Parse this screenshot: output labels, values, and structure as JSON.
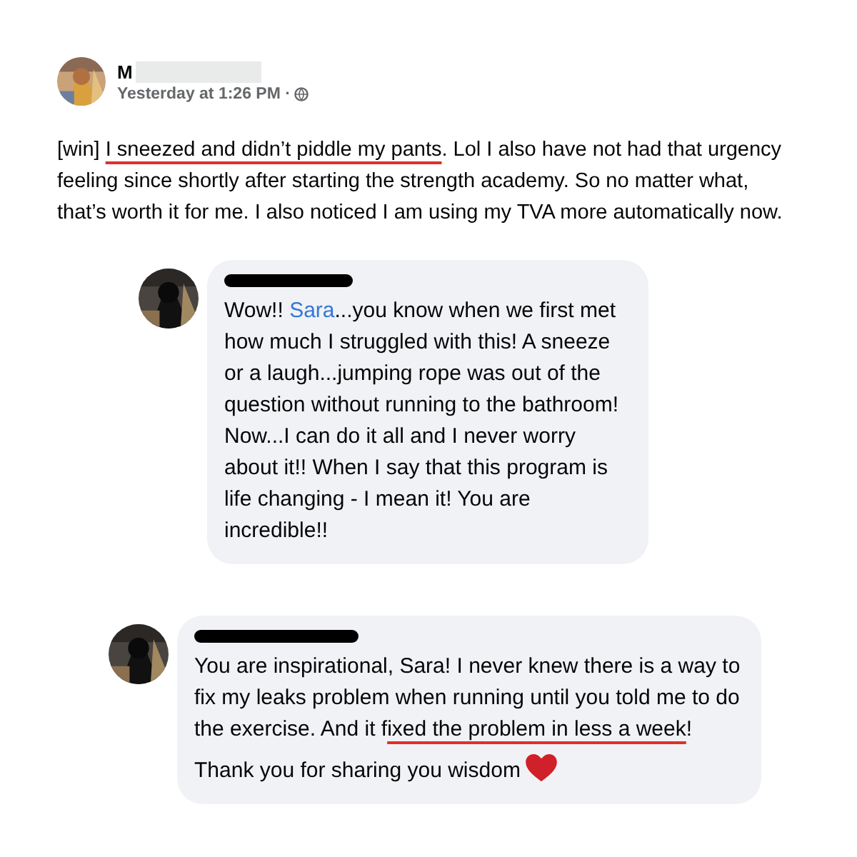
{
  "post": {
    "author": "M",
    "time": "Yesterday at 1:26 PM ·",
    "body": [
      {
        "text": "[win] ",
        "kind": "plain"
      },
      {
        "text": "I sneezed and didn’t piddle my pants",
        "kind": "underlined"
      },
      {
        "text": ". Lol I also have not had that urgency feeling since shortly after starting the strength academy. So no matter what, that’s worth it for me. I also noticed I am using my TVA more automatically now.",
        "kind": "plain"
      }
    ]
  },
  "comments": [
    {
      "author_redacted": true,
      "paragraphs": [
        [
          {
            "text": "Wow!! ",
            "kind": "plain"
          },
          {
            "text": "Sara",
            "kind": "mention"
          },
          {
            "text": "...you know when we first met how much I struggled with this! A sneeze or a laugh...jumping rope was out of the question without running to the bathroom! Now...I can do it all and I never worry about it!! When I say that this program is life changing - I mean it! You are incredible!!",
            "kind": "plain"
          }
        ]
      ]
    },
    {
      "author_redacted": true,
      "paragraphs": [
        [
          {
            "text": "You are inspirational, Sara! I never knew there is a way to fix my leaks problem when running until you told me to do the exercise. And it f",
            "kind": "plain"
          },
          {
            "text": "ixed the problem in less a week",
            "kind": "underlined"
          },
          {
            "text": "!",
            "kind": "plain"
          }
        ],
        [
          {
            "text": "Thank you for sharing you wisdom",
            "kind": "plain"
          },
          {
            "kind": "heart"
          }
        ]
      ]
    }
  ]
}
